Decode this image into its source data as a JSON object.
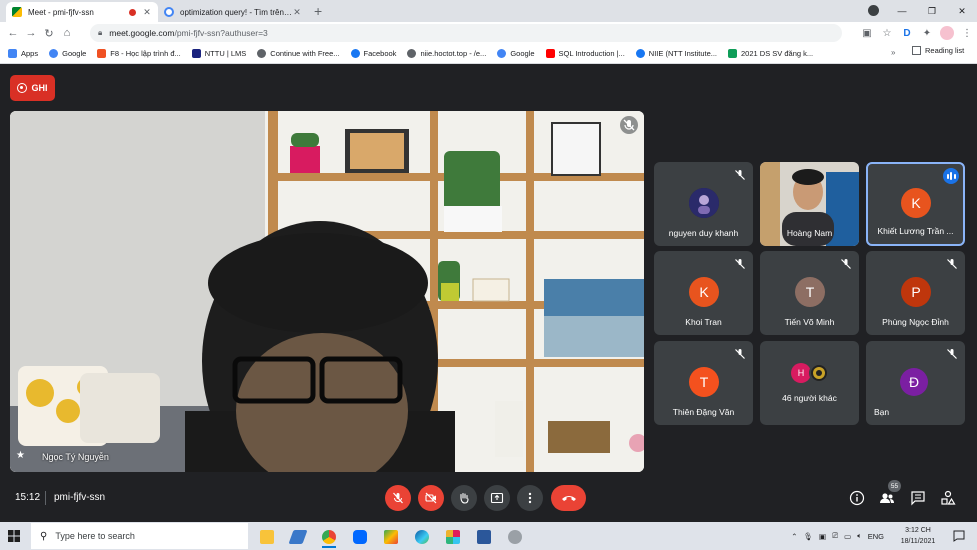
{
  "browser": {
    "tabs": [
      {
        "title": "Meet - pmi-fjfv-ssn",
        "active": true,
        "recording": true
      },
      {
        "title": "optimization query! - Tìm trên Gi",
        "active": false
      }
    ],
    "address": {
      "host": "meet.google.com",
      "path": "/pmi-fjfv-ssn?authuser=3"
    },
    "bookmarks": [
      {
        "label": "Apps",
        "color": "#4285f4"
      },
      {
        "label": "Google",
        "color": "#4285f4"
      },
      {
        "label": "F8 - Học lập trình đ...",
        "color": "#f05123"
      },
      {
        "label": "NTTU | LMS",
        "color": "#1a237e"
      },
      {
        "label": "Continue with Free...",
        "color": "#5f6368"
      },
      {
        "label": "Facebook",
        "color": "#1877f2"
      },
      {
        "label": "niie.hoctot.top - /e...",
        "color": "#5f6368"
      },
      {
        "label": "Google",
        "color": "#4285f4"
      },
      {
        "label": "SQL Introduction |...",
        "color": "#ff0000"
      },
      {
        "label": "NIIE (NTT Institute...",
        "color": "#1877f2"
      },
      {
        "label": "2021 DS SV đăng k...",
        "color": "#0f9d58"
      }
    ],
    "bookmarks_more": "»",
    "reading_list": "Reading list"
  },
  "meet": {
    "record_label": "GHI",
    "main_speaker": "Ngọc Tý Nguyễn",
    "participants": [
      {
        "name": "nguyen duy khanh",
        "kind": "photo-avatar",
        "muted": true
      },
      {
        "name": "Hoàng Nam",
        "kind": "video",
        "muted": false
      },
      {
        "name": "Khiết Lương Trần ...",
        "initial": "K",
        "color": "#e8541e",
        "speaking": true
      },
      {
        "name": "Khoi Tran",
        "initial": "K",
        "color": "#e8541e",
        "muted": true
      },
      {
        "name": "Tiến Võ Minh",
        "initial": "T",
        "color": "#8d6e63",
        "muted": true
      },
      {
        "name": "Phùng Ngọc Đỉnh",
        "initial": "P",
        "color": "#bf360c",
        "muted": true
      },
      {
        "name": "Thiên Đặng Văn",
        "initial": "T",
        "color": "#f4511e",
        "muted": true
      },
      {
        "name": "46 người khác",
        "initial": "H",
        "color": "#d81b60",
        "group": true
      },
      {
        "name": "Bạn",
        "initial": "Đ",
        "color": "#7b1fa2",
        "muted": true
      }
    ],
    "time": "15:12",
    "meeting_code": "pmi-fjfv-ssn",
    "people_count": "55"
  },
  "taskbar": {
    "search_placeholder": "Type here to search",
    "language": "ENG",
    "time": "3:12 CH",
    "date": "18/11/2021"
  }
}
